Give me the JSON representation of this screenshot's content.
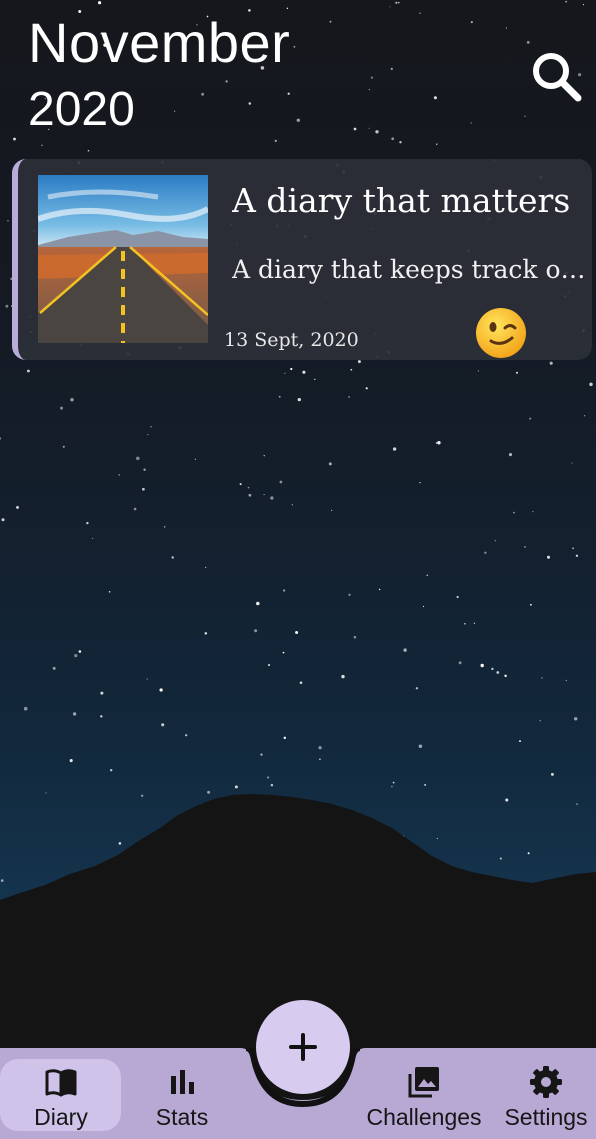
{
  "header": {
    "month": "November",
    "year": "2020",
    "search_icon": "search-icon"
  },
  "entries": [
    {
      "title": "A diary that matters",
      "preview": "A diary that keeps track of your memories",
      "date": "13 Sept, 2020",
      "mood_icon": "winking-face-emoji",
      "image": "road-landscape-thumbnail"
    }
  ],
  "fab": {
    "icon": "plus-icon"
  },
  "bottom_nav": {
    "items": [
      {
        "label": "Diary",
        "icon": "book-icon",
        "active": true
      },
      {
        "label": "Stats",
        "icon": "bar-chart-icon",
        "active": false
      },
      {
        "label": "Challenges",
        "icon": "photo-library-icon",
        "active": false
      },
      {
        "label": "Settings",
        "icon": "gear-icon",
        "active": false
      }
    ]
  },
  "colors": {
    "accent": "#cfc3ea",
    "nav_background": "#b7a9d4",
    "card_background": "#2c2f38",
    "card_border": "#b8acd8"
  }
}
